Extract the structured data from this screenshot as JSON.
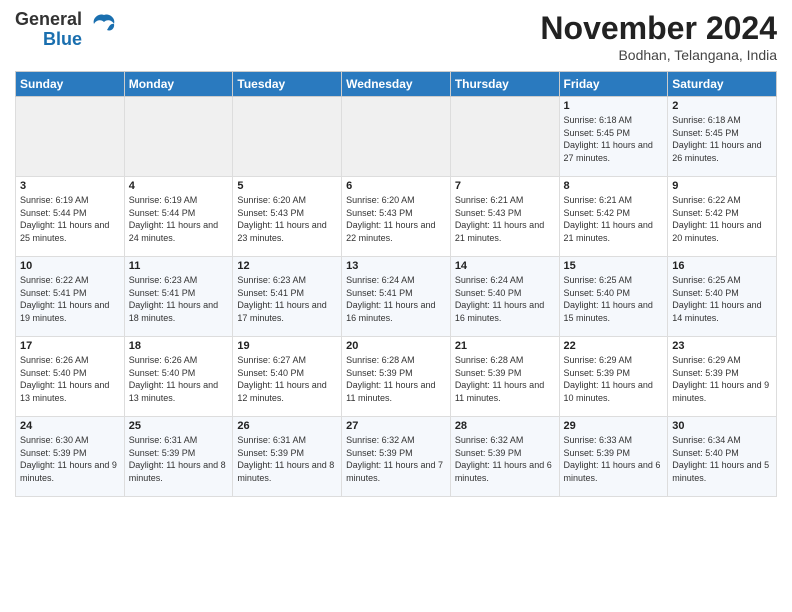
{
  "logo": {
    "line1": "General",
    "line2": "Blue"
  },
  "title": "November 2024",
  "location": "Bodhan, Telangana, India",
  "weekdays": [
    "Sunday",
    "Monday",
    "Tuesday",
    "Wednesday",
    "Thursday",
    "Friday",
    "Saturday"
  ],
  "weeks": [
    [
      {
        "day": "",
        "info": ""
      },
      {
        "day": "",
        "info": ""
      },
      {
        "day": "",
        "info": ""
      },
      {
        "day": "",
        "info": ""
      },
      {
        "day": "",
        "info": ""
      },
      {
        "day": "1",
        "info": "Sunrise: 6:18 AM\nSunset: 5:45 PM\nDaylight: 11 hours and 27 minutes."
      },
      {
        "day": "2",
        "info": "Sunrise: 6:18 AM\nSunset: 5:45 PM\nDaylight: 11 hours and 26 minutes."
      }
    ],
    [
      {
        "day": "3",
        "info": "Sunrise: 6:19 AM\nSunset: 5:44 PM\nDaylight: 11 hours and 25 minutes."
      },
      {
        "day": "4",
        "info": "Sunrise: 6:19 AM\nSunset: 5:44 PM\nDaylight: 11 hours and 24 minutes."
      },
      {
        "day": "5",
        "info": "Sunrise: 6:20 AM\nSunset: 5:43 PM\nDaylight: 11 hours and 23 minutes."
      },
      {
        "day": "6",
        "info": "Sunrise: 6:20 AM\nSunset: 5:43 PM\nDaylight: 11 hours and 22 minutes."
      },
      {
        "day": "7",
        "info": "Sunrise: 6:21 AM\nSunset: 5:43 PM\nDaylight: 11 hours and 21 minutes."
      },
      {
        "day": "8",
        "info": "Sunrise: 6:21 AM\nSunset: 5:42 PM\nDaylight: 11 hours and 21 minutes."
      },
      {
        "day": "9",
        "info": "Sunrise: 6:22 AM\nSunset: 5:42 PM\nDaylight: 11 hours and 20 minutes."
      }
    ],
    [
      {
        "day": "10",
        "info": "Sunrise: 6:22 AM\nSunset: 5:41 PM\nDaylight: 11 hours and 19 minutes."
      },
      {
        "day": "11",
        "info": "Sunrise: 6:23 AM\nSunset: 5:41 PM\nDaylight: 11 hours and 18 minutes."
      },
      {
        "day": "12",
        "info": "Sunrise: 6:23 AM\nSunset: 5:41 PM\nDaylight: 11 hours and 17 minutes."
      },
      {
        "day": "13",
        "info": "Sunrise: 6:24 AM\nSunset: 5:41 PM\nDaylight: 11 hours and 16 minutes."
      },
      {
        "day": "14",
        "info": "Sunrise: 6:24 AM\nSunset: 5:40 PM\nDaylight: 11 hours and 16 minutes."
      },
      {
        "day": "15",
        "info": "Sunrise: 6:25 AM\nSunset: 5:40 PM\nDaylight: 11 hours and 15 minutes."
      },
      {
        "day": "16",
        "info": "Sunrise: 6:25 AM\nSunset: 5:40 PM\nDaylight: 11 hours and 14 minutes."
      }
    ],
    [
      {
        "day": "17",
        "info": "Sunrise: 6:26 AM\nSunset: 5:40 PM\nDaylight: 11 hours and 13 minutes."
      },
      {
        "day": "18",
        "info": "Sunrise: 6:26 AM\nSunset: 5:40 PM\nDaylight: 11 hours and 13 minutes."
      },
      {
        "day": "19",
        "info": "Sunrise: 6:27 AM\nSunset: 5:40 PM\nDaylight: 11 hours and 12 minutes."
      },
      {
        "day": "20",
        "info": "Sunrise: 6:28 AM\nSunset: 5:39 PM\nDaylight: 11 hours and 11 minutes."
      },
      {
        "day": "21",
        "info": "Sunrise: 6:28 AM\nSunset: 5:39 PM\nDaylight: 11 hours and 11 minutes."
      },
      {
        "day": "22",
        "info": "Sunrise: 6:29 AM\nSunset: 5:39 PM\nDaylight: 11 hours and 10 minutes."
      },
      {
        "day": "23",
        "info": "Sunrise: 6:29 AM\nSunset: 5:39 PM\nDaylight: 11 hours and 9 minutes."
      }
    ],
    [
      {
        "day": "24",
        "info": "Sunrise: 6:30 AM\nSunset: 5:39 PM\nDaylight: 11 hours and 9 minutes."
      },
      {
        "day": "25",
        "info": "Sunrise: 6:31 AM\nSunset: 5:39 PM\nDaylight: 11 hours and 8 minutes."
      },
      {
        "day": "26",
        "info": "Sunrise: 6:31 AM\nSunset: 5:39 PM\nDaylight: 11 hours and 8 minutes."
      },
      {
        "day": "27",
        "info": "Sunrise: 6:32 AM\nSunset: 5:39 PM\nDaylight: 11 hours and 7 minutes."
      },
      {
        "day": "28",
        "info": "Sunrise: 6:32 AM\nSunset: 5:39 PM\nDaylight: 11 hours and 6 minutes."
      },
      {
        "day": "29",
        "info": "Sunrise: 6:33 AM\nSunset: 5:39 PM\nDaylight: 11 hours and 6 minutes."
      },
      {
        "day": "30",
        "info": "Sunrise: 6:34 AM\nSunset: 5:40 PM\nDaylight: 11 hours and 5 minutes."
      }
    ]
  ]
}
